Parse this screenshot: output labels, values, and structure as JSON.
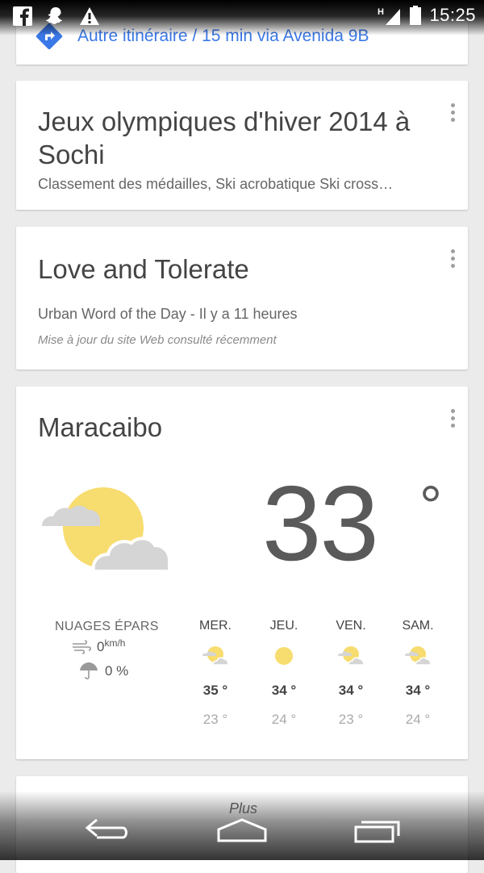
{
  "status_bar": {
    "time": "15:25",
    "icons": [
      "facebook-icon",
      "snapchat-icon",
      "warning-icon",
      "signal-icon",
      "battery-icon"
    ]
  },
  "route_card": {
    "text": "Autre itinéraire / 15 min via Avenida 9B",
    "icon": "directions-icon",
    "color": "#3b78e7"
  },
  "olympics_card": {
    "title": "Jeux olympiques d'hiver 2014 à Sochi",
    "subtitle": "Classement des médailles, Ski acrobatique Ski cross…"
  },
  "word_card": {
    "title": "Love and Tolerate",
    "subtitle": "Urban Word of the Day - Il y a 11 heures",
    "note": "Mise à jour du site Web consulté récemment"
  },
  "weather_card": {
    "city": "Maracaibo",
    "temperature": "33",
    "degree": "°",
    "condition": "NUAGES ÉPARS",
    "wind": "0",
    "wind_unit": "km/h",
    "rain": "0 %",
    "forecast": [
      {
        "day": "MER.",
        "icon": "partly-cloudy-icon",
        "high": "35 °",
        "low": "23 °"
      },
      {
        "day": "JEU.",
        "icon": "sunny-icon",
        "high": "34 °",
        "low": "24 °"
      },
      {
        "day": "VEN.",
        "icon": "partly-cloudy-icon",
        "high": "34 °",
        "low": "23 °"
      },
      {
        "day": "SAM.",
        "icon": "partly-cloudy-icon",
        "high": "34 °",
        "low": "24 °"
      }
    ]
  },
  "nav": {
    "plus_label": "Plus"
  }
}
